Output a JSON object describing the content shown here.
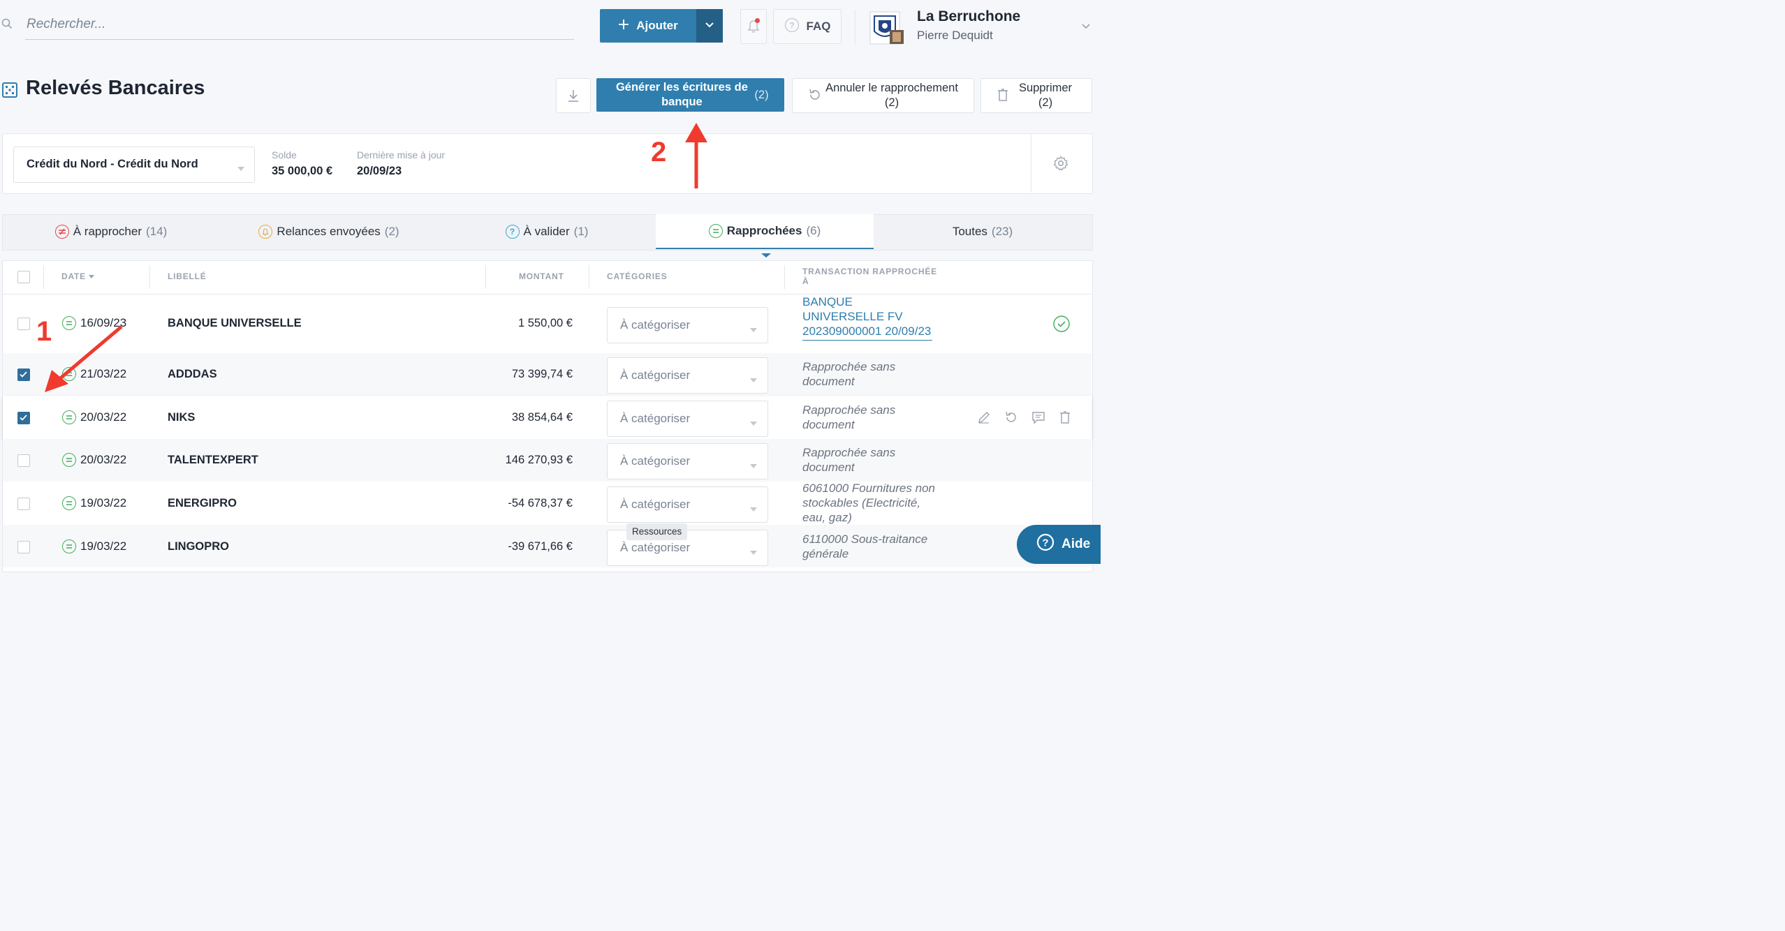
{
  "search": {
    "placeholder": "Rechercher..."
  },
  "topbar": {
    "add_label": "Ajouter",
    "faq_label": "FAQ",
    "company_name": "La Berruchone",
    "user_name": "Pierre Dequidt"
  },
  "page": {
    "title": "Relevés Bancaires",
    "actions": {
      "generate_label": "Générer les écritures de banque",
      "generate_count": "(2)",
      "cancel_label": "Annuler le rapprochement (2)",
      "delete_label": "Supprimer (2)"
    }
  },
  "account": {
    "selected": "Crédit du Nord - Crédit du Nord",
    "solde_label": "Solde",
    "solde_value": "35 000,00 €",
    "update_label": "Dernière mise à jour",
    "update_value": "20/09/23"
  },
  "tabs": [
    {
      "label": "À rapprocher",
      "count": "(14)"
    },
    {
      "label": "Relances envoyées",
      "count": "(2)"
    },
    {
      "label": "À valider",
      "count": "(1)"
    },
    {
      "label": "Rapprochées",
      "count": "(6)"
    },
    {
      "label": "Toutes",
      "count": "(23)"
    }
  ],
  "table": {
    "headers": {
      "date": "DATE",
      "libelle": "LIBELLÉ",
      "montant": "MONTANT",
      "categories": "CATÉGORIES",
      "transaction": "TRANSACTION RAPPROCHÉE À"
    },
    "rows": [
      {
        "date": "16/09/23",
        "libelle": "BANQUE UNIVERSELLE",
        "montant": "1 550,00 €",
        "categorie": "À catégoriser",
        "transaction": "BANQUE UNIVERSELLE FV 202309000001 20/09/23",
        "checked": false
      },
      {
        "date": "21/03/22",
        "libelle": "ADDDAS",
        "montant": "73 399,74 €",
        "categorie": "À catégoriser",
        "transaction": "Rapprochée sans document",
        "checked": true
      },
      {
        "date": "20/03/22",
        "libelle": "NIKS",
        "montant": "38 854,64 €",
        "categorie": "À catégoriser",
        "transaction": "Rapprochée sans document",
        "checked": true
      },
      {
        "date": "20/03/22",
        "libelle": "TALENTEXPERT",
        "montant": "146 270,93 €",
        "categorie": "À catégoriser",
        "transaction": "Rapprochée sans document",
        "checked": false
      },
      {
        "date": "19/03/22",
        "libelle": "ENERGIPRO",
        "montant": "-54 678,37 €",
        "categorie": "À catégoriser",
        "transaction": "6061000 Fournitures non stockables (Electricité, eau, gaz)",
        "checked": false
      },
      {
        "date": "19/03/22",
        "libelle": "LINGOPRO",
        "montant": "-39 671,66 €",
        "categorie": "À catégoriser",
        "transaction": "6110000 Sous-traitance générale",
        "checked": false
      }
    ]
  },
  "tooltip": "Ressources",
  "help_label": "Aide",
  "annotations": {
    "step1": "1",
    "step2": "2",
    "color": "#f03a2e"
  },
  "colors": {
    "primary": "#2f7eae",
    "success": "#3fae5c"
  }
}
